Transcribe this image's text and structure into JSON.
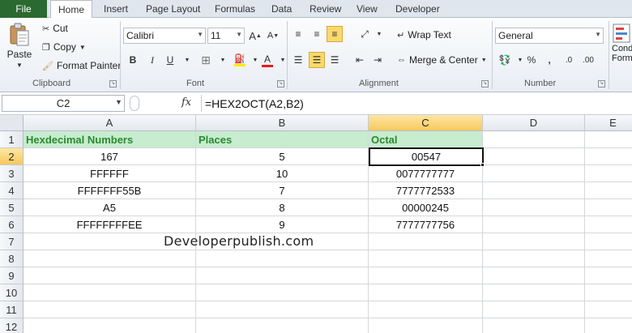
{
  "tabs": {
    "file": "File",
    "items": [
      "Home",
      "Insert",
      "Page Layout",
      "Formulas",
      "Data",
      "Review",
      "View",
      "Developer"
    ]
  },
  "ribbon": {
    "clipboard": {
      "paste": "Paste",
      "cut": "Cut",
      "copy": "Copy",
      "format_painter": "Format Painter",
      "label": "Clipboard"
    },
    "font": {
      "name": "Calibri",
      "size": "11",
      "label": "Font",
      "bold": "B",
      "italic": "I",
      "underline": "U",
      "grow": "A",
      "shrink": "A",
      "font_color_letter": "A",
      "font_color": "#e02020",
      "fill_color": "#ffe800"
    },
    "alignment": {
      "wrap_text": "Wrap Text",
      "merge_center": "Merge & Center",
      "label": "Alignment"
    },
    "number": {
      "format": "General",
      "percent": "%",
      "comma": ",",
      "label": "Number"
    },
    "styles": {
      "conditional_line1": "Cond",
      "conditional_line2": "Form"
    }
  },
  "formula_bar": {
    "name_box": "C2",
    "fx": "fx",
    "formula": "=HEX2OCT(A2,B2)"
  },
  "sheet": {
    "columns": [
      "A",
      "B",
      "C",
      "D",
      "E"
    ],
    "rows": [
      "1",
      "2",
      "3",
      "4",
      "5",
      "6",
      "7",
      "8",
      "9",
      "10",
      "11",
      "12"
    ],
    "header_row": [
      "Hexdecimal Numbers",
      "Places",
      "Octal"
    ],
    "data": [
      [
        "167",
        "5",
        "00547"
      ],
      [
        "FFFFFF",
        "10",
        "0077777777"
      ],
      [
        "FFFFFFF55B",
        "7",
        "7777772533"
      ],
      [
        "A5",
        "8",
        "00000245"
      ],
      [
        "FFFFFFFFEE",
        "9",
        "7777777756"
      ]
    ],
    "watermark": "Developerpublish.com",
    "active_cell": "C2",
    "header_fill": "#c7eccf",
    "header_text_color": "#2a8a2f"
  }
}
